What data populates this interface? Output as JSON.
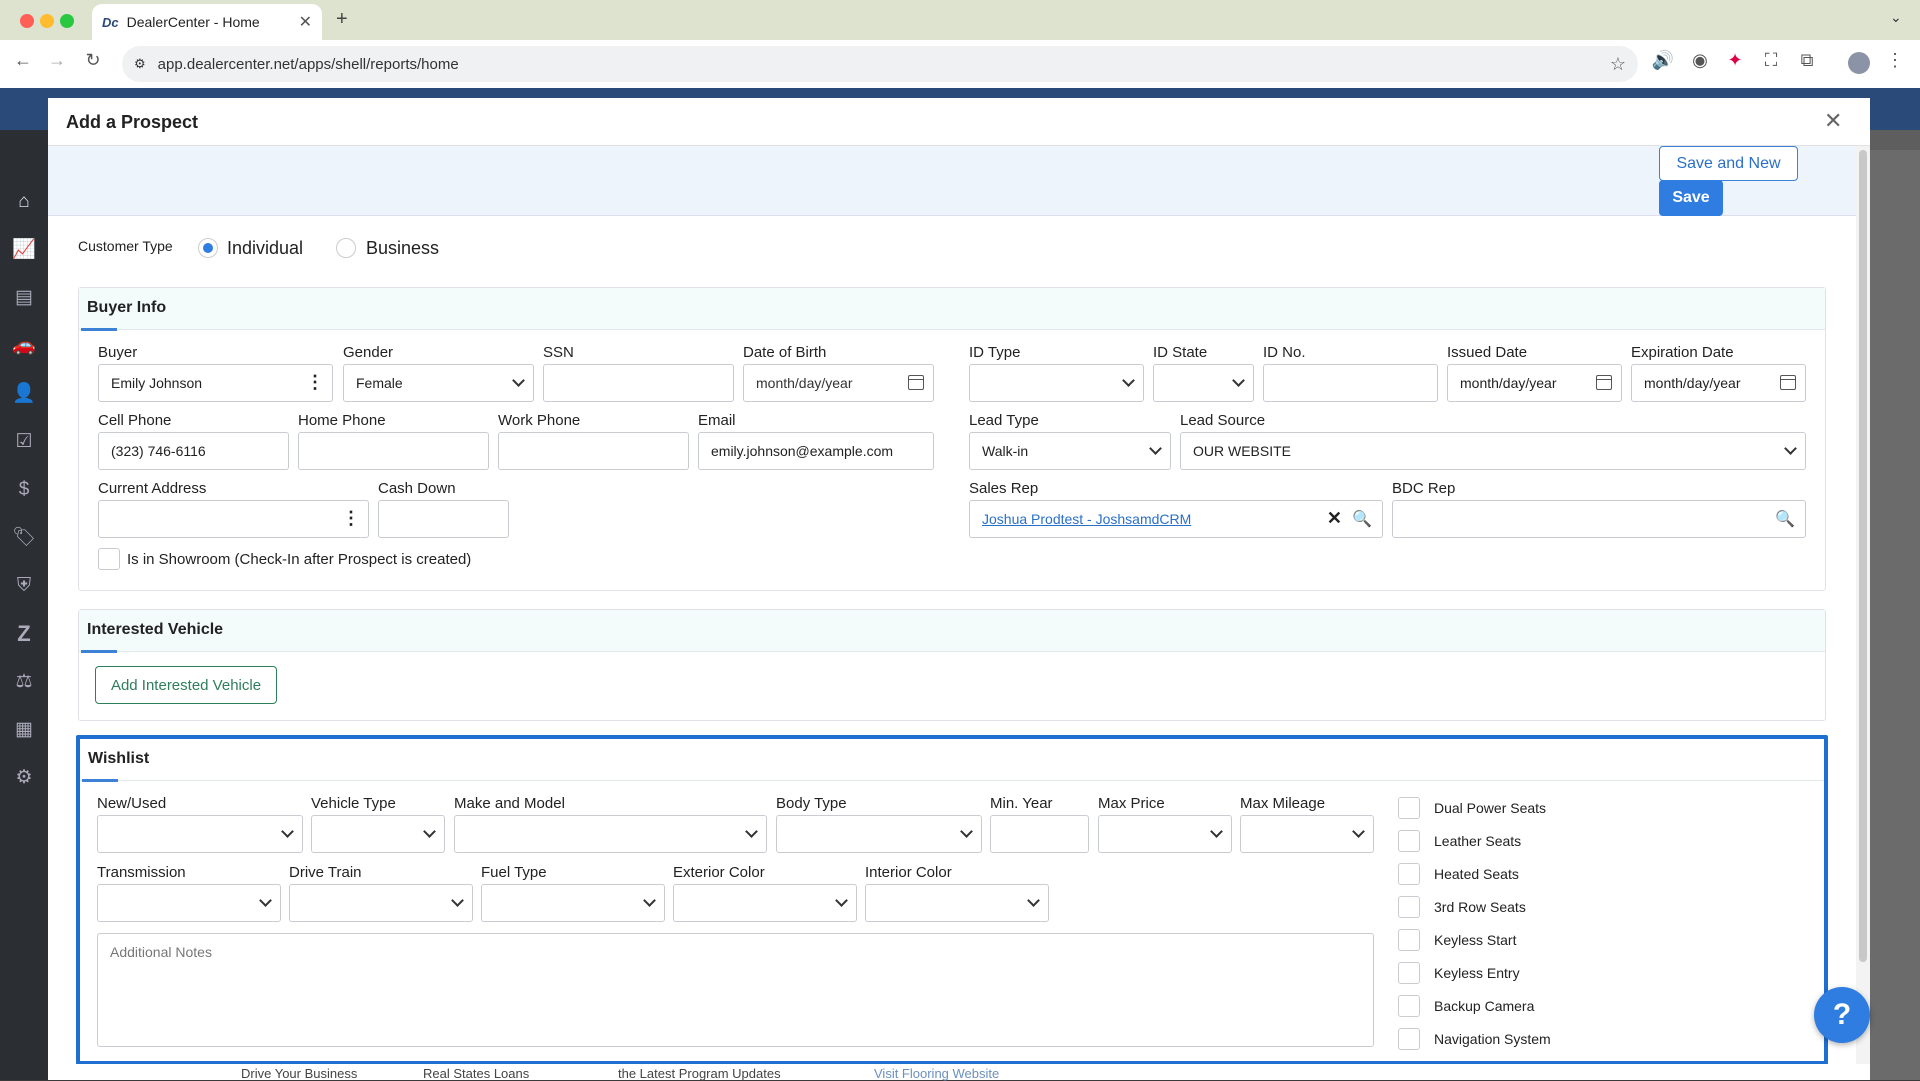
{
  "browser": {
    "tab_title": "DealerCenter - Home",
    "tab_icon": "Dc",
    "url": "app.dealercenter.net/apps/shell/reports/home"
  },
  "modal": {
    "title": "Add a Prospect",
    "save_and_new": "Save and New",
    "save": "Save"
  },
  "customer_type": {
    "label": "Customer Type",
    "option_individual": "Individual",
    "option_business": "Business",
    "selected": "Individual"
  },
  "buyer_info": {
    "title": "Buyer Info",
    "buyer_label": "Buyer",
    "buyer_value": "Emily Johnson",
    "gender_label": "Gender",
    "gender_value": "Female",
    "ssn_label": "SSN",
    "ssn_value": "",
    "dob_label": "Date of Birth",
    "dob_placeholder": "month/day/year",
    "id_type_label": "ID Type",
    "id_type_value": "",
    "id_state_label": "ID State",
    "id_state_value": "",
    "id_no_label": "ID No.",
    "id_no_value": "",
    "issued_label": "Issued Date",
    "issued_placeholder": "month/day/year",
    "expiration_label": "Expiration Date",
    "expiration_placeholder": "month/day/year",
    "cell_label": "Cell Phone",
    "cell_value": "(323) 746-6116",
    "home_label": "Home Phone",
    "home_value": "",
    "work_label": "Work Phone",
    "work_value": "",
    "email_label": "Email",
    "email_value": "emily.johnson@example.com",
    "lead_type_label": "Lead Type",
    "lead_type_value": "Walk-in",
    "lead_source_label": "Lead Source",
    "lead_source_value": "OUR WEBSITE",
    "address_label": "Current Address",
    "address_value": "",
    "cash_down_label": "Cash Down",
    "cash_down_value": "",
    "sales_rep_label": "Sales Rep",
    "sales_rep_value": "Joshua Prodtest - JoshsamdCRM",
    "bdc_rep_label": "BDC Rep",
    "bdc_rep_value": "",
    "showroom_label": "Is in Showroom (Check-In after Prospect is created)"
  },
  "interested_vehicle": {
    "title": "Interested Vehicle",
    "add_button": "Add Interested Vehicle"
  },
  "wishlist": {
    "title": "Wishlist",
    "new_used_label": "New/Used",
    "vehicle_type_label": "Vehicle Type",
    "make_model_label": "Make and Model",
    "body_type_label": "Body Type",
    "min_year_label": "Min. Year",
    "max_price_label": "Max Price",
    "max_mileage_label": "Max Mileage",
    "transmission_label": "Transmission",
    "drive_train_label": "Drive Train",
    "fuel_type_label": "Fuel Type",
    "exterior_color_label": "Exterior Color",
    "interior_color_label": "Interior Color",
    "notes_placeholder": "Additional Notes",
    "features": [
      "Dual Power Seats",
      "Leather Seats",
      "Heated Seats",
      "3rd Row Seats",
      "Keyless Start",
      "Keyless Entry",
      "Backup Camera",
      "Navigation System"
    ]
  },
  "background_strip": [
    "Drive Your Business",
    "Real States Loans",
    "the Latest Program Updates",
    "Visit Flooring Website"
  ],
  "help_label": "?",
  "colors": {
    "accent": "#2f7de1",
    "wishlist_border": "#1f6fd1",
    "link": "#2a6fc9"
  }
}
